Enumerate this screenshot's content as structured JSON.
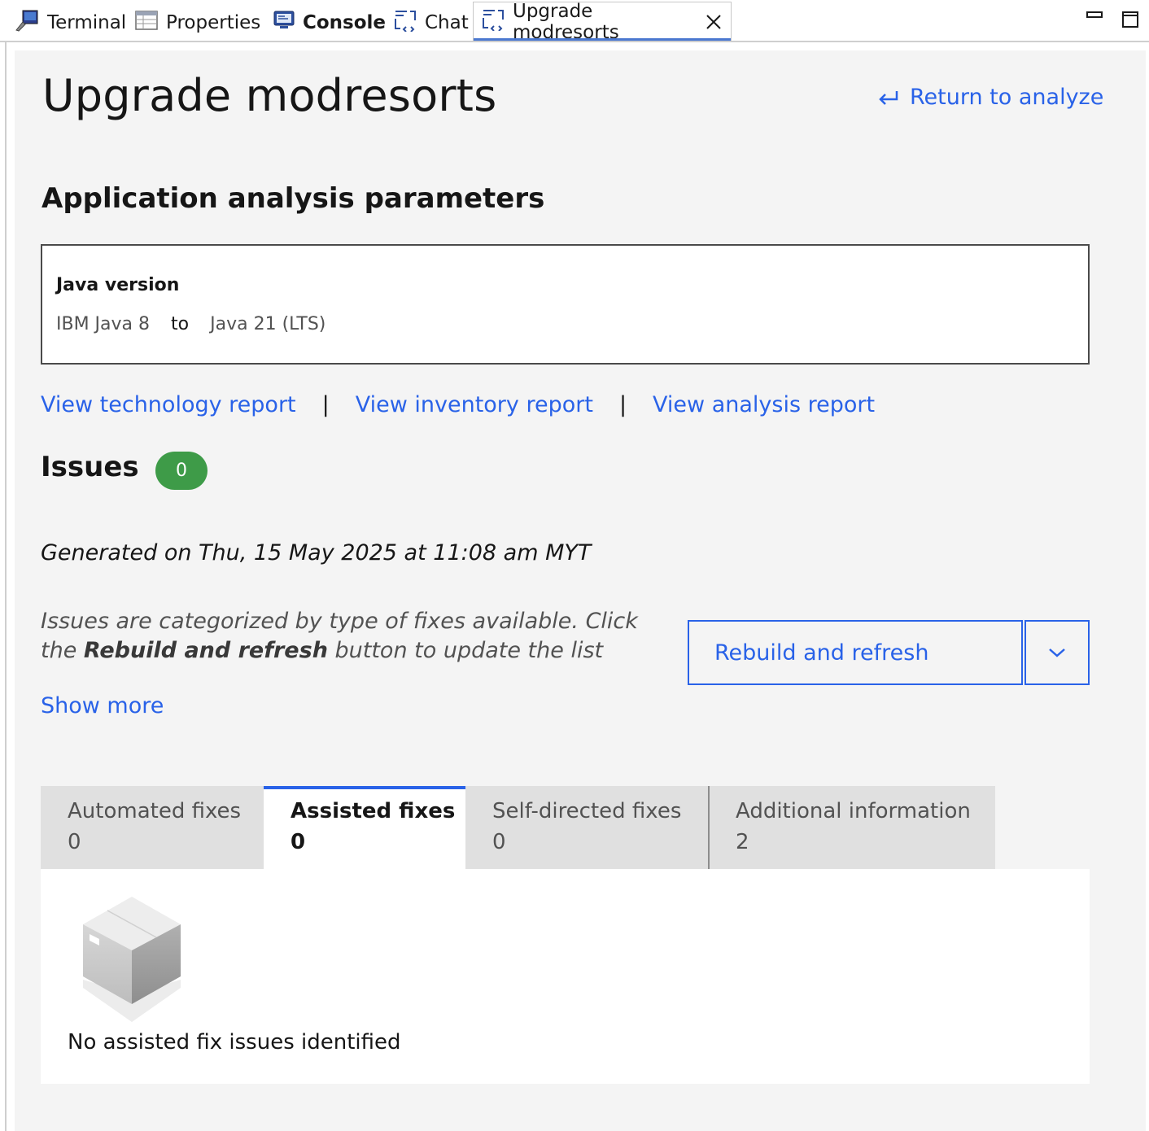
{
  "view_tabs": [
    {
      "label": "Terminal",
      "icon": "terminal-icon"
    },
    {
      "label": "Properties",
      "icon": "properties-icon"
    },
    {
      "label": "Console",
      "icon": "console-icon"
    },
    {
      "label": "Chat",
      "icon": "chat-icon"
    },
    {
      "label": "Upgrade modresorts",
      "icon": "chat-icon",
      "active": true
    }
  ],
  "page": {
    "title": "Upgrade modresorts",
    "return_label": "Return to analyze"
  },
  "parameters": {
    "heading": "Application analysis parameters",
    "java_label": "Java version",
    "from": "IBM Java 8",
    "to_word": "to",
    "to": "Java 21 (LTS)"
  },
  "links": {
    "technology": "View technology report",
    "inventory": "View inventory report",
    "analysis": "View analysis report",
    "separator": "|"
  },
  "issues": {
    "heading": "Issues",
    "count": "0",
    "generated": "Generated on Thu, 15 May 2025 at 11:08 am MYT",
    "desc_pre": "Issues are categorized by type of fixes available. Click the ",
    "desc_bold": "Rebuild and refresh",
    "desc_post": " button to update the list",
    "show_more": "Show more"
  },
  "actions": {
    "rebuild_label": "Rebuild and refresh"
  },
  "content_tabs": [
    {
      "label": "Automated fixes",
      "count": "0"
    },
    {
      "label": "Assisted fixes",
      "count": "0",
      "selected": true
    },
    {
      "label": "Self-directed fixes",
      "count": "0"
    },
    {
      "label": "Additional information",
      "count": "2"
    }
  ],
  "empty_state": {
    "message": "No assisted fix issues identified",
    "icon": "empty-box-icon"
  },
  "colors": {
    "link": "#2962e8",
    "badge": "#3e9b48",
    "panel_bg": "#f4f4f4"
  }
}
